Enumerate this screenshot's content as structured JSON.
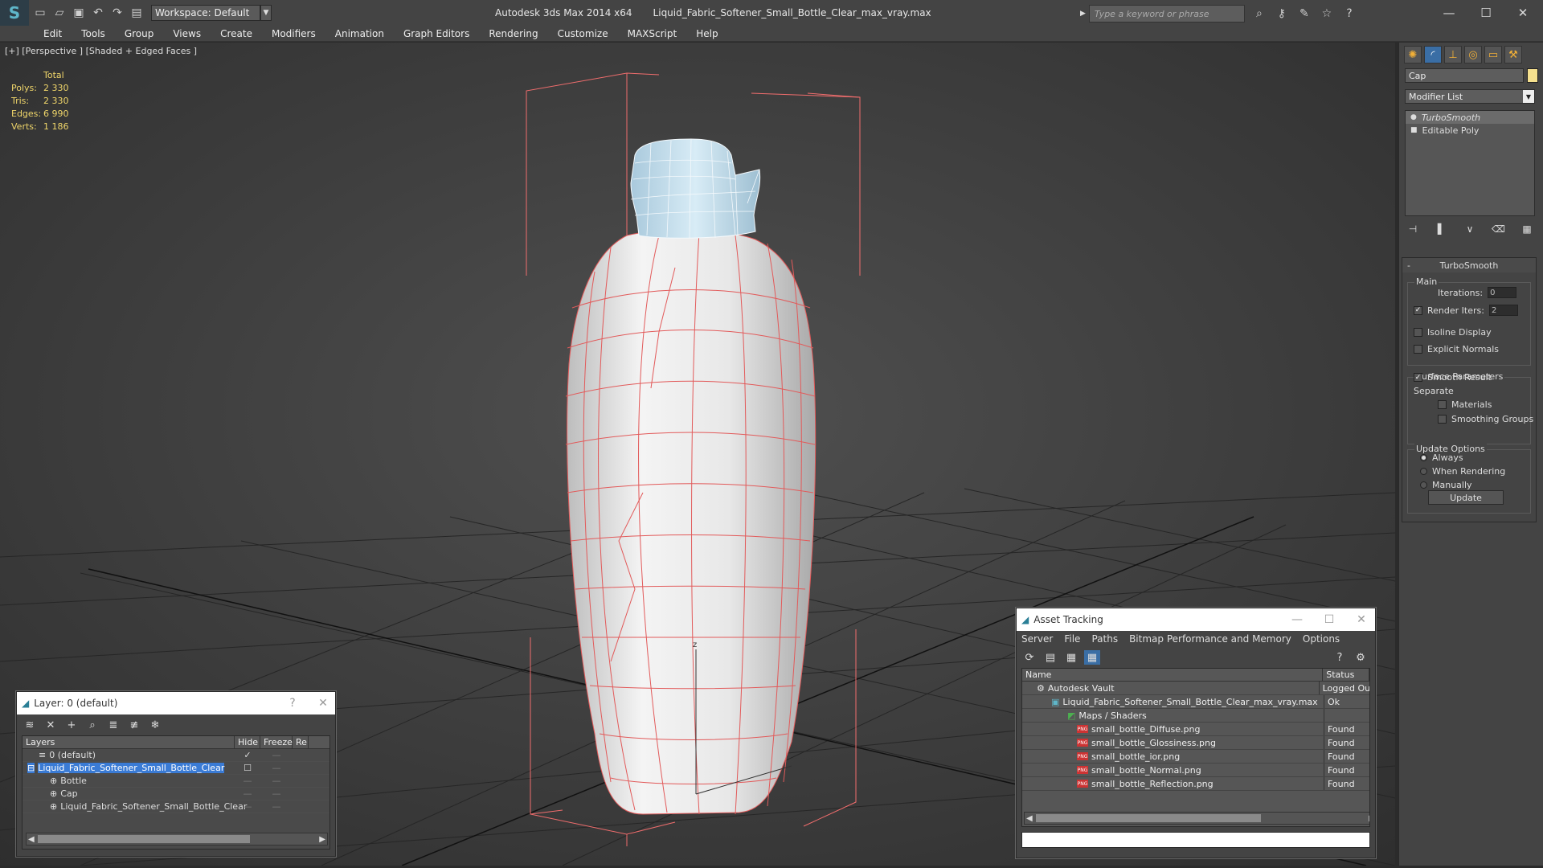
{
  "titlebar": {
    "workspace": "Workspace: Default",
    "app_title": "Autodesk 3ds Max  2014 x64",
    "file_title": "Liquid_Fabric_Softener_Small_Bottle_Clear_max_vray.max",
    "search_placeholder": "Type a keyword or phrase"
  },
  "menu": [
    "Edit",
    "Tools",
    "Group",
    "Views",
    "Create",
    "Modifiers",
    "Animation",
    "Graph Editors",
    "Rendering",
    "Customize",
    "MAXScript",
    "Help"
  ],
  "viewport": {
    "label": "[+] [Perspective ] [Shaded + Edged Faces ]",
    "stats_header": "Total",
    "stats": [
      {
        "label": "Polys:",
        "value": "2 330"
      },
      {
        "label": "Tris:",
        "value": "2 330"
      },
      {
        "label": "Edges:",
        "value": "6 990"
      },
      {
        "label": "Verts:",
        "value": "1 186"
      }
    ],
    "axis_label": "z"
  },
  "command_panel": {
    "object_name": "Cap",
    "object_color": "#f5e08e",
    "modifier_list": "Modifier List",
    "stack": [
      "TurboSmooth",
      "Editable Poly"
    ],
    "rollout_title": "TurboSmooth",
    "main_group": "Main",
    "iterations_label": "Iterations:",
    "iterations_value": "0",
    "render_iters_label": "Render Iters:",
    "render_iters_value": "2",
    "isoline_label": "Isoline Display",
    "explicit_normals_label": "Explicit Normals",
    "surface_group": "Surface Parameters",
    "smooth_result_label": "Smooth Result",
    "separate_label": "Separate",
    "materials_label": "Materials",
    "smoothing_groups_label": "Smoothing Groups",
    "update_group": "Update Options",
    "always_label": "Always",
    "when_rendering_label": "When Rendering",
    "manually_label": "Manually",
    "update_button": "Update"
  },
  "layer_window": {
    "title": "Layer: 0 (default)",
    "help": "?",
    "close": "✕",
    "columns": [
      "Layers",
      "Hide",
      "Freeze",
      "Re"
    ],
    "rows": [
      {
        "name": "0 (default)",
        "indent": 1
      },
      {
        "name": "Liquid_Fabric_Softener_Small_Bottle_Clear",
        "indent": 1
      },
      {
        "name": "Bottle",
        "indent": 2
      },
      {
        "name": "Cap",
        "indent": 2
      },
      {
        "name": "Liquid_Fabric_Softener_Small_Bottle_Clear",
        "indent": 2
      }
    ]
  },
  "asset_window": {
    "title": "Asset Tracking",
    "menu": [
      "Server",
      "File",
      "Paths",
      "Bitmap Performance and Memory",
      "Options"
    ],
    "columns": [
      "Name",
      "Status"
    ],
    "rows": [
      {
        "name": "Autodesk Vault",
        "status": "Logged Ou",
        "level": 0
      },
      {
        "name": "Liquid_Fabric_Softener_Small_Bottle_Clear_max_vray.max",
        "status": "Ok",
        "level": 1
      },
      {
        "name": "Maps / Shaders",
        "status": "",
        "level": 2
      },
      {
        "name": "small_bottle_Diffuse.png",
        "status": "Found",
        "level": 3
      },
      {
        "name": "small_bottle_Glossiness.png",
        "status": "Found",
        "level": 3
      },
      {
        "name": "small_bottle_ior.png",
        "status": "Found",
        "level": 3
      },
      {
        "name": "small_bottle_Normal.png",
        "status": "Found",
        "level": 3
      },
      {
        "name": "small_bottle_Reflection.png",
        "status": "Found",
        "level": 3
      }
    ]
  }
}
